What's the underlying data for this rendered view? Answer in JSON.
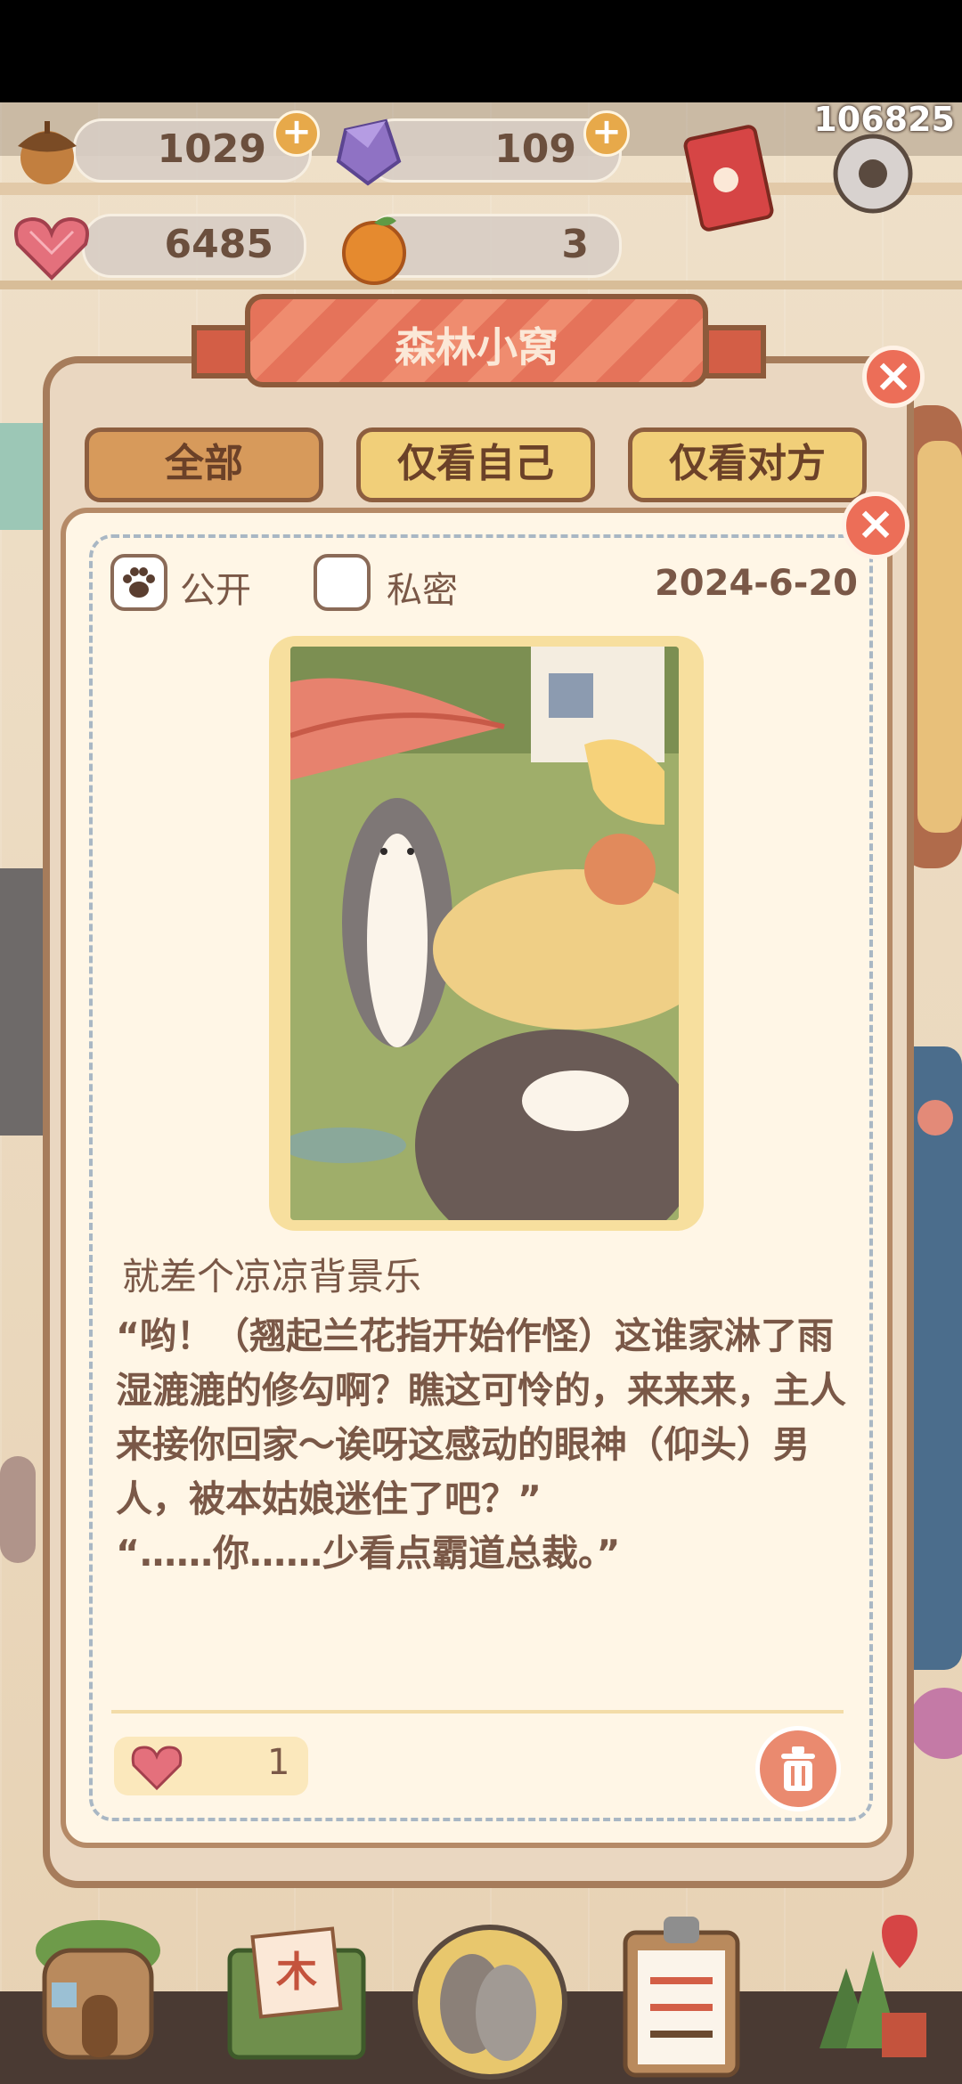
{
  "status": {
    "score": "106825"
  },
  "resources": {
    "acorn": {
      "value": "1029",
      "plus": "+"
    },
    "gem": {
      "value": "109",
      "plus": "+"
    },
    "heart": {
      "value": "6485"
    },
    "orange": {
      "value": "3"
    }
  },
  "dialog": {
    "title": "森林小窝",
    "close": "×",
    "tabs": [
      {
        "label": "全部",
        "active": true
      },
      {
        "label": "仅看自己",
        "active": false
      },
      {
        "label": "仅看对方",
        "active": false
      }
    ]
  },
  "post": {
    "close": "×",
    "public_label": "公开",
    "public_checked": true,
    "private_label": "私密",
    "private_checked": false,
    "date": "2024-6-20",
    "title": "就差个凉凉背景乐",
    "body": "“哟！（翘起兰花指开始作怪）这谁家淋了雨湿漉漉的修勾啊？瞧这可怜的，来来来，主人来接你回家～诶呀这感动的眼神（仰头）男人，被本姑娘迷住了吧？”\n“……你……少看点霸道总裁。”",
    "likes": "1"
  },
  "colors": {
    "accent": "#e5735a",
    "tab_active": "#d79a5b",
    "tab_inactive": "#f1cf79",
    "text": "#7a5847"
  },
  "nav": {
    "items": [
      "home-icon",
      "mail-icon",
      "gacha-icon",
      "tasks-icon",
      "map-icon"
    ]
  }
}
